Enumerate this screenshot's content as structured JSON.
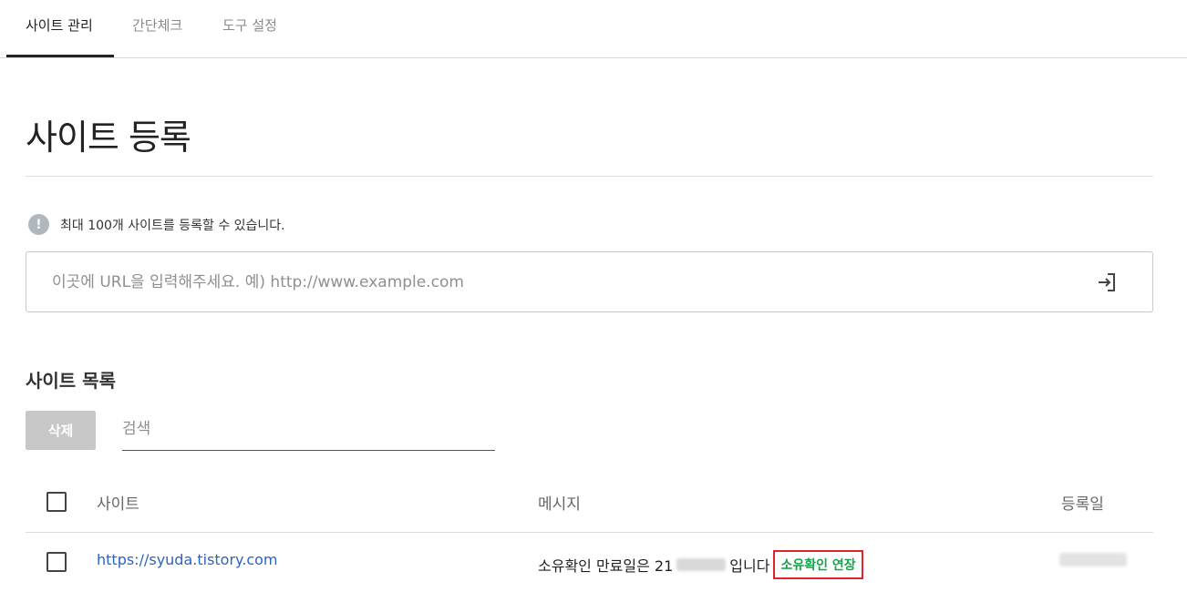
{
  "tabs": [
    {
      "label": "사이트 관리",
      "active": true
    },
    {
      "label": "간단체크",
      "active": false
    },
    {
      "label": "도구 설정",
      "active": false
    }
  ],
  "page_title": "사이트 등록",
  "notice": {
    "icon": "info-icon",
    "icon_glyph": "!",
    "text": "최대 100개 사이트를 등록할 수 있습니다."
  },
  "url_input": {
    "placeholder": "이곳에 URL을 입력해주세요. 예) http://www.example.com",
    "value": "",
    "submit_icon": "login-arrow-icon"
  },
  "site_list": {
    "title": "사이트 목록",
    "delete_label": "삭제",
    "search_placeholder": "검색",
    "columns": {
      "site": "사이트",
      "message": "메시지",
      "date": "등록일"
    },
    "rows": [
      {
        "site": "https://syuda.tistory.com",
        "message_prefix": "소유확인 만료일은 21",
        "message_suffix": "입니다",
        "extend_label": "소유확인 연장",
        "date": ""
      }
    ]
  },
  "colors": {
    "link": "#2a64c5",
    "extend_text": "#16a34a",
    "highlight_border": "#e0242c",
    "delete_button": "#c7c7c7"
  }
}
